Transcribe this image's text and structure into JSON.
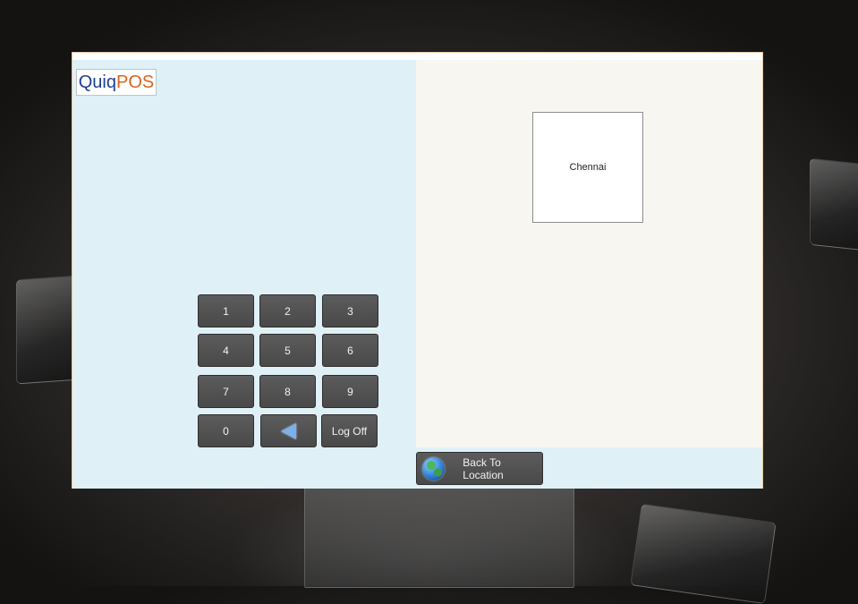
{
  "logo": {
    "part1": "Quiq",
    "part2": "POS"
  },
  "keypad": {
    "keys": [
      "1",
      "2",
      "3",
      "4",
      "5",
      "6",
      "7",
      "8",
      "9",
      "0"
    ],
    "backspace_icon": "back-arrow-icon",
    "logoff_label": "Log Off"
  },
  "location": {
    "name": "Chennai"
  },
  "footer": {
    "back_label": "Back To Location",
    "back_icon": "globe-icon"
  },
  "colors": {
    "left_pane": "#dff1f7",
    "right_pane": "#f7f6f1",
    "button": "#505050",
    "logo_blue": "#1d3f8f",
    "logo_orange": "#d9641e"
  }
}
